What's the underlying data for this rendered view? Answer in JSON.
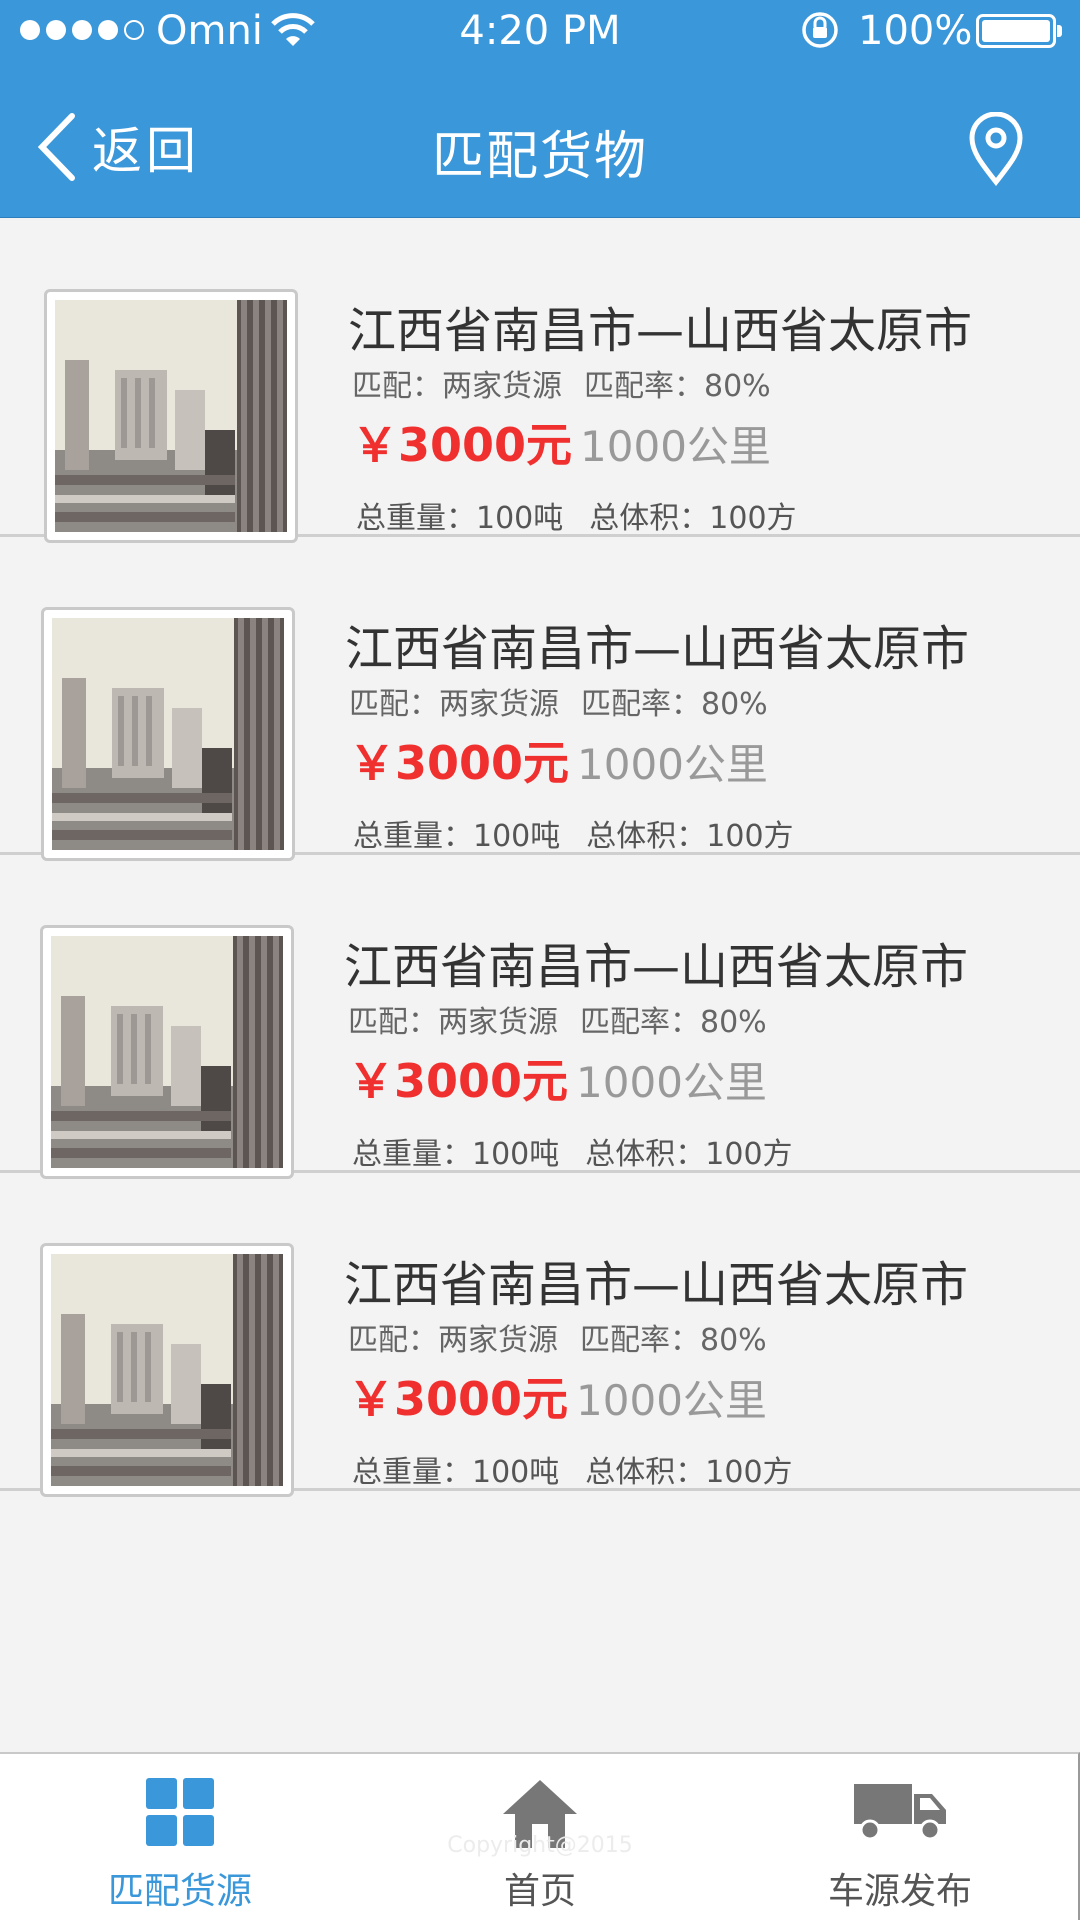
{
  "status_bar": {
    "carrier": "Omni",
    "time": "4:20 PM",
    "battery": "100%"
  },
  "nav": {
    "back_label": "返回",
    "title": "匹配货物",
    "location_icon": "location-pin-icon"
  },
  "colors": {
    "brand_blue": "#3a97d9",
    "price_red": "#f0302e"
  },
  "items": [
    {
      "route": "江西省南昌市—山西省太原市",
      "match": "匹配：两家货源",
      "rate": "匹配率：80%",
      "price": "￥3000元",
      "distance": "1000公里",
      "weight": "总重量：100吨",
      "volume": "总体积：100方"
    },
    {
      "route": "江西省南昌市—山西省太原市",
      "match": "匹配：两家货源",
      "rate": "匹配率：80%",
      "price": "￥3000元",
      "distance": "1000公里",
      "weight": "总重量：100吨",
      "volume": "总体积：100方"
    },
    {
      "route": "江西省南昌市—山西省太原市",
      "match": "匹配：两家货源",
      "rate": "匹配率：80%",
      "price": "￥3000元",
      "distance": "1000公里",
      "weight": "总重量：100吨",
      "volume": "总体积：100方"
    },
    {
      "route": "江西省南昌市—山西省太原市",
      "match": "匹配：两家货源",
      "rate": "匹配率：80%",
      "price": "￥3000元",
      "distance": "1000公里",
      "weight": "总重量：100吨",
      "volume": "总体积：100方"
    }
  ],
  "tabbar": {
    "tabs": [
      {
        "label": "匹配货源",
        "icon": "grid-icon",
        "active": true
      },
      {
        "label": "首页",
        "icon": "home-icon",
        "active": false
      },
      {
        "label": "车源发布",
        "icon": "truck-icon",
        "active": false
      }
    ],
    "copyright": "Copyright@2015"
  }
}
